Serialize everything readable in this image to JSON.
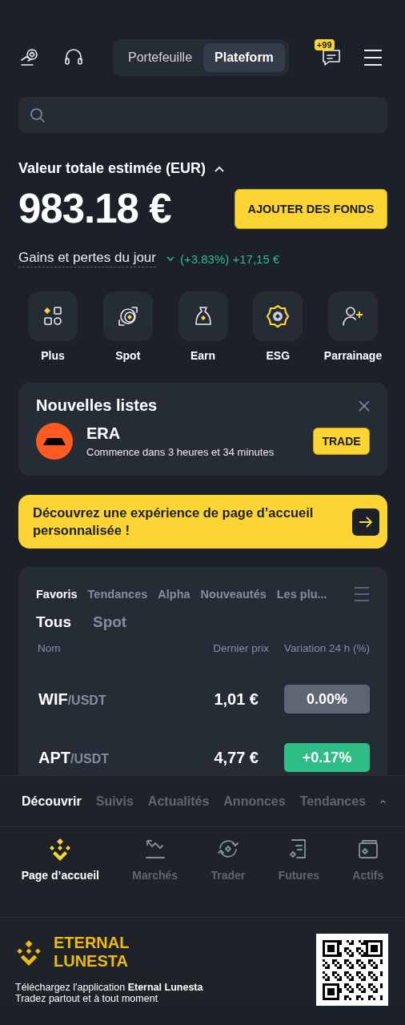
{
  "header": {
    "tabs": [
      {
        "label": "Portefeuille",
        "selected": false
      },
      {
        "label": "Plateform",
        "selected": true
      }
    ],
    "badge": "+99"
  },
  "balance": {
    "title": "Valeur totale estimée (EUR)",
    "expanded": true,
    "amount": "983.18 €",
    "button": "AJOUTER DES FONDS",
    "pnl_label": "Gains et pertes du jour",
    "pnl_value": "(+3.83%) +17,15 €"
  },
  "shortcuts": [
    {
      "label": "Plus",
      "kind": "plus"
    },
    {
      "label": "Spot",
      "kind": "spot"
    },
    {
      "label": "Earn",
      "kind": "earn"
    },
    {
      "label": "ESG",
      "kind": "esg"
    },
    {
      "label": "Parrainage",
      "kind": "referral"
    }
  ],
  "new_listing": {
    "title": "Nouvelles listes",
    "coin": "ERA",
    "subtitle": "Commence dans 3 heures et 34 minutes",
    "button": "TRADE"
  },
  "promo": {
    "text": "Découvrez une expérience de page d’accueil personnalisée !"
  },
  "markets": {
    "tabs": [
      {
        "label": "Favoris",
        "selected": true
      },
      {
        "label": "Tendances",
        "selected": false
      },
      {
        "label": "Alpha",
        "selected": false
      },
      {
        "label": "Nouveautés",
        "selected": false
      },
      {
        "label": "Les plu...",
        "selected": false
      }
    ],
    "subtabs": [
      {
        "label": "Tous",
        "selected": true
      },
      {
        "label": "Spot",
        "selected": false
      }
    ],
    "columns": [
      "Nom",
      "Dernier prix",
      "Variation 24 h (%)"
    ],
    "rows": [
      {
        "base": "WIF",
        "quote": "/USDT",
        "price": "1,01 €",
        "change": "0.00%",
        "color": "#5e6673"
      },
      {
        "base": "APT",
        "quote": "/USDT",
        "price": "4,77 €",
        "change": "+0.17%",
        "color": "#2ebd85"
      }
    ]
  },
  "feed_tabs": [
    {
      "label": "Découvrir",
      "selected": true
    },
    {
      "label": "Suivis",
      "selected": false
    },
    {
      "label": "Actualités",
      "selected": false
    },
    {
      "label": "Annonces",
      "selected": false
    },
    {
      "label": "Tendances",
      "selected": false
    }
  ],
  "nav": [
    {
      "label": "Page d’accueil",
      "kind": "home",
      "selected": true
    },
    {
      "label": "Marchés",
      "kind": "markets",
      "selected": false
    },
    {
      "label": "Trader",
      "kind": "trade",
      "selected": false
    },
    {
      "label": "Futures",
      "kind": "futures",
      "selected": false
    },
    {
      "label": "Actifs",
      "kind": "assets",
      "selected": false
    }
  ],
  "footer": {
    "brand": "ETERNAL LUNESTA",
    "line1": "Téléchargez l'application **Eternal Lunesta**",
    "line2": "Tradez partout et à tout moment"
  }
}
